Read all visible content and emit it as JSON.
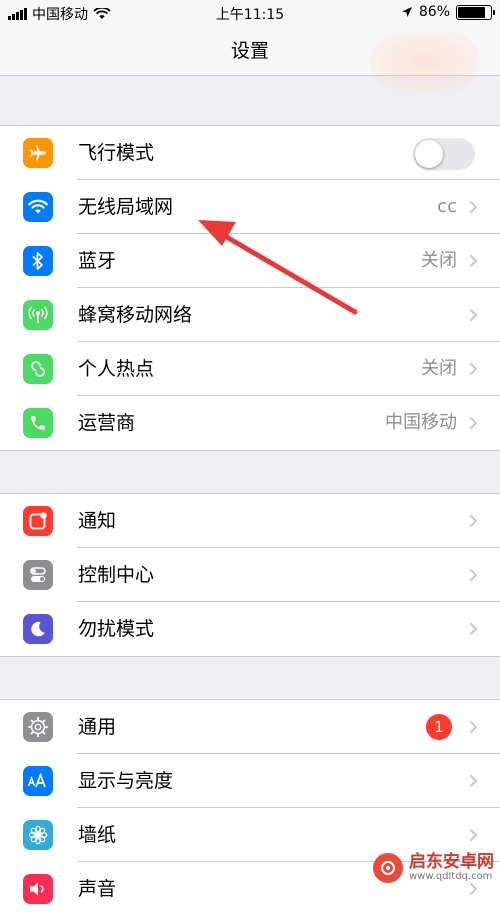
{
  "status_bar": {
    "carrier": "中国移动",
    "time": "上午11:15",
    "battery_text": "86%",
    "battery_level": 0.86
  },
  "nav": {
    "title": "设置"
  },
  "groups": [
    [
      {
        "label": "飞行模式",
        "icon": "airplane-icon",
        "color": "#ff9500",
        "toggle": false
      },
      {
        "label": "无线局域网",
        "icon": "wifi-icon",
        "color": "#007aff",
        "value": "cc"
      },
      {
        "label": "蓝牙",
        "icon": "bluetooth-icon",
        "color": "#007aff",
        "value": "关闭"
      },
      {
        "label": "蜂窝移动网络",
        "icon": "cellular-antenna-icon",
        "color": "#4cd964",
        "value": ""
      },
      {
        "label": "个人热点",
        "icon": "hotspot-icon",
        "color": "#4cd964",
        "value": "关闭"
      },
      {
        "label": "运营商",
        "icon": "phone-icon",
        "color": "#4cd964",
        "value": "中国移动"
      }
    ],
    [
      {
        "label": "通知",
        "icon": "notifications-icon",
        "color": "#ff3b30",
        "value": ""
      },
      {
        "label": "控制中心",
        "icon": "control-center-icon",
        "color": "#8e8e93",
        "value": ""
      },
      {
        "label": "勿扰模式",
        "icon": "moon-icon",
        "color": "#5856d6",
        "value": ""
      }
    ],
    [
      {
        "label": "通用",
        "icon": "gear-icon",
        "color": "#8e8e93",
        "badge": "1"
      },
      {
        "label": "显示与亮度",
        "icon": "display-aa-icon",
        "color": "#007aff",
        "value": ""
      },
      {
        "label": "墙纸",
        "icon": "flower-icon",
        "color": "#34aadc",
        "value": ""
      },
      {
        "label": "声音",
        "icon": "speaker-icon",
        "color": "#ff2d55",
        "value": ""
      }
    ]
  ],
  "watermark": {
    "title": "启东安卓网",
    "url": "www.qdltdq.com"
  },
  "annotation": {
    "color": "#e53a35"
  }
}
